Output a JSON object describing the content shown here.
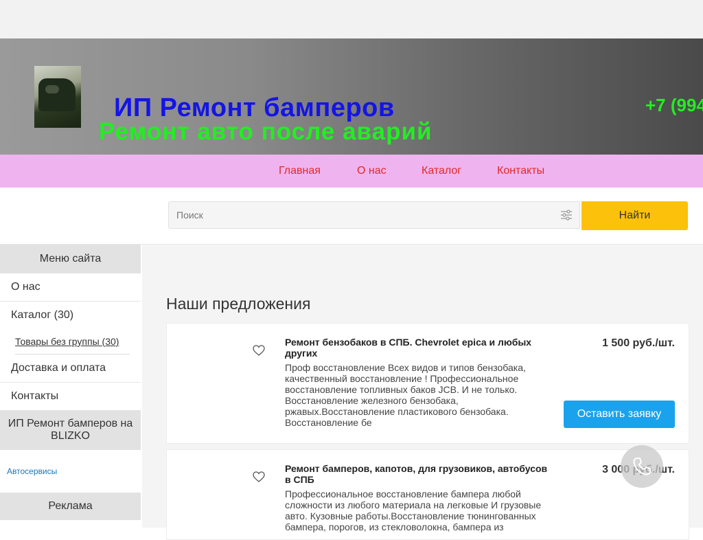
{
  "header": {
    "title": "ИП Ремонт бамперов",
    "subtitle": "Ремонт авто после аварий",
    "phone": "+7 (994"
  },
  "nav": {
    "items": [
      {
        "label": "Главная"
      },
      {
        "label": "О нас"
      },
      {
        "label": "Каталог"
      },
      {
        "label": "Контакты"
      }
    ]
  },
  "search": {
    "placeholder": "Поиск",
    "button_label": "Найти"
  },
  "sidebar": {
    "menu_heading": "Меню сайта",
    "items": [
      {
        "label": "О нас"
      },
      {
        "label": "Каталог (30)"
      },
      {
        "label": "Товары без группы (30)"
      },
      {
        "label": "Доставка и оплата"
      },
      {
        "label": "Контакты"
      }
    ],
    "blizko_heading": "ИП Ремонт бамперов на BLIZKO",
    "blizko_link": "Автосервисы",
    "ads_heading": "Реклама"
  },
  "main": {
    "section_title": "Наши предложения",
    "products": [
      {
        "title": "Ремонт бензобаков в СПБ. Chevrolet epica и любых других",
        "description": "Проф восстановление Всех видов и типов бензобака, качественный восстановление ! Профессиональное восстановление топливных баков JCB. И не только. Восстановление железного бензобака, ржавых.Восстановление пластикового бензобака. Восстановление бе",
        "price": "1 500 руб./шт.",
        "button_label": "Оставить заявку"
      },
      {
        "title": "Ремонт бамперов, капотов, для грузовиков, автобусов в СПБ",
        "description": "Профессиональное восстановление бампера любой сложности из любого материала на легковые И грузовые авто. Кузовные работы.Восстановление тюнингованных бампера, порогов, из стекловолокна, бампера из",
        "price": "3 000 руб./шт."
      }
    ]
  },
  "colors": {
    "title_blue": "#1414e6",
    "title_green": "#22ee22",
    "nav_bg": "#efb3ef",
    "nav_link": "#e02a2a",
    "search_button": "#fcc10a",
    "order_button": "#1aa3ec"
  },
  "icons": [
    "filter-sliders-icon",
    "heart-icon",
    "phone-call-icon"
  ]
}
